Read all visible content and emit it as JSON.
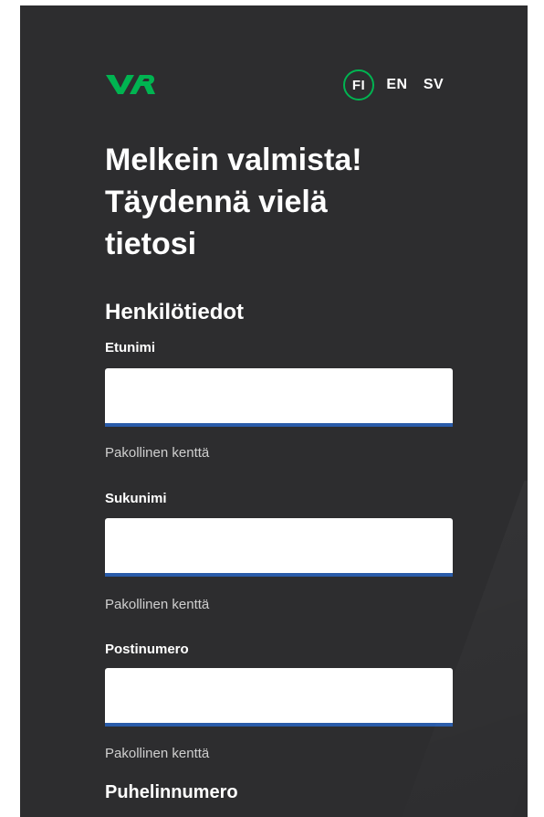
{
  "brand": {
    "logo_icon": "vr-logo",
    "accent_color": "#00b451"
  },
  "languages": [
    {
      "label": "FI",
      "active": true
    },
    {
      "label": "EN",
      "active": false
    },
    {
      "label": "SV",
      "active": false
    }
  ],
  "title_lines": [
    "Melkein valmista!",
    "Täydennä vielä",
    "tietosi"
  ],
  "section_personal": "Henkilötiedot",
  "fields": [
    {
      "label": "Etunimi",
      "value": "",
      "help": "Pakollinen kenttä"
    },
    {
      "label": "Sukunimi",
      "value": "",
      "help": "Pakollinen kenttä"
    },
    {
      "label": "Postinumero",
      "value": "",
      "help": "Pakollinen kenttä"
    }
  ],
  "next_label": "Puhelinnumero",
  "colors": {
    "background": "#2d2d2f",
    "input_underline": "#2a5caa"
  }
}
